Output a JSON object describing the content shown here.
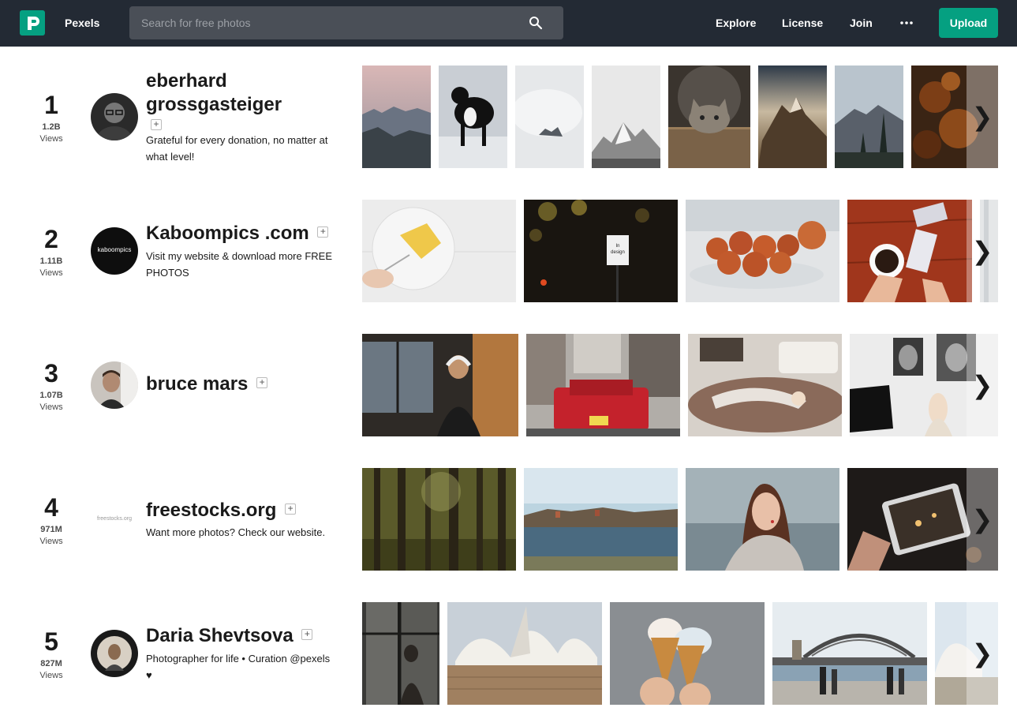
{
  "header": {
    "brand": "Pexels",
    "search_placeholder": "Search for free photos",
    "nav": {
      "explore": "Explore",
      "license": "License",
      "join": "Join"
    },
    "upload": "Upload",
    "colors": {
      "bar": "#232a34",
      "accent": "#05a081"
    }
  },
  "arrow_glyph": "❯",
  "follow_glyph": "+",
  "rows": [
    {
      "rank": "1",
      "views": "1.2B",
      "views_label": "Views",
      "name_line1": "eberhard",
      "name_line2": "grossgasteiger",
      "bio": "Grateful for every donation, no matter at what level!",
      "photos": [
        "pink mountain dusk",
        "black and white dog in snow",
        "misty snowy peak",
        "snowy mountain black and white",
        "cat peeking from box",
        "mountain at sunset",
        "mountain silhouette with trees",
        "autumn leaves bokeh"
      ]
    },
    {
      "rank": "2",
      "views": "1.11B",
      "views_label": "Views",
      "name": "Kaboompics .com",
      "avatar_text": "kaboompics",
      "bio": "Visit my website & download more FREE PHOTOS",
      "photos": [
        "cake on white plate",
        "night street sign bokeh",
        "pastries in glass bowl",
        "coffee and phone on red table",
        "partial photo"
      ]
    },
    {
      "rank": "3",
      "views": "1.07B",
      "views_label": "Views",
      "name": "bruce mars",
      "bio": "",
      "photos": [
        "man with headphones and phone",
        "red taxi in city",
        "woman lying on rug",
        "woman near piano with portraits"
      ]
    },
    {
      "rank": "4",
      "views": "971M",
      "views_label": "Views",
      "name": "freestocks.org",
      "avatar_text": "freestocks.org",
      "bio": "Want more photos? Check our website.",
      "photos": [
        "forest trees",
        "lake with town reflection",
        "woman with scarf",
        "phone taking photo of lights"
      ]
    },
    {
      "rank": "5",
      "views": "827M",
      "views_label": "Views",
      "name": "Daria Shevtsova",
      "bio_line": "Photographer for life • Curation @pexels",
      "bio_heart": "♥",
      "photos": [
        "person behind window",
        "opera house roof",
        "two ice cream cones",
        "harbour bridge",
        "opera house partial"
      ]
    }
  ]
}
